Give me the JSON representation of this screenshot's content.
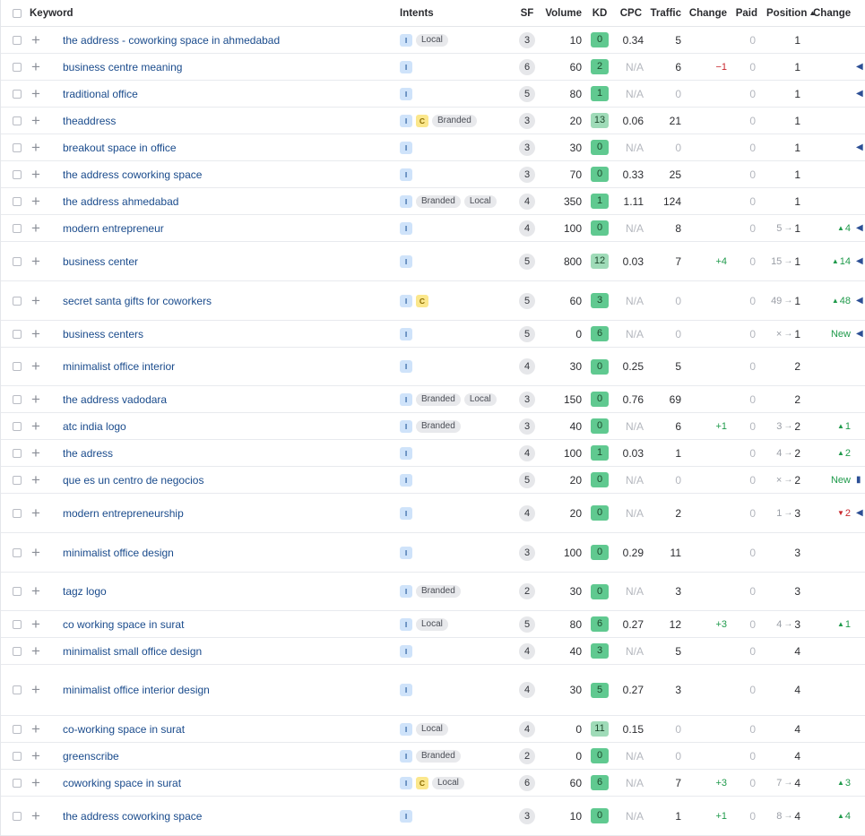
{
  "header": {
    "keyword": "Keyword",
    "intents": "Intents",
    "sf": "SF",
    "volume": "Volume",
    "kd": "KD",
    "cpc": "CPC",
    "traffic": "Traffic",
    "traffic_change": "Change",
    "paid": "Paid",
    "position": "Position",
    "position_sort_icon": "▲",
    "position_change": "Change"
  },
  "colors": {
    "link": "#1a4b8c",
    "kd_green": "#60c990",
    "kd_light_green": "#9fdbb8",
    "positive": "#1f9a4b",
    "negative": "#c8262c",
    "intent_i_bg": "#cfe3fa",
    "intent_c_bg": "#fbe78c"
  },
  "rows": [
    {
      "keyword": "the address - coworking space in ahmedabad",
      "intents": [
        "I"
      ],
      "tags": [
        "Local"
      ],
      "sf": "3",
      "volume": "10",
      "kd": "0",
      "cpc": "0.34",
      "traffic": "5",
      "tchg": "",
      "paid": "0",
      "prev": "",
      "pos": "1",
      "pchg": "",
      "pchg_dir": "",
      "feature": "",
      "h": 29
    },
    {
      "keyword": "business centre meaning",
      "intents": [
        "I"
      ],
      "tags": [],
      "sf": "6",
      "volume": "60",
      "kd": "2",
      "cpc": "N/A",
      "traffic": "6",
      "tchg": "−1",
      "tchg_dir": "down",
      "paid": "0",
      "prev": "",
      "pos": "1",
      "pchg": "",
      "pchg_dir": "",
      "feature": "◀",
      "h": 29
    },
    {
      "keyword": "traditional office",
      "intents": [
        "I"
      ],
      "tags": [],
      "sf": "5",
      "volume": "80",
      "kd": "1",
      "cpc": "N/A",
      "traffic": "0",
      "tchg": "",
      "paid": "0",
      "prev": "",
      "pos": "1",
      "pchg": "",
      "pchg_dir": "",
      "feature": "◀",
      "h": 29
    },
    {
      "keyword": "theaddress",
      "intents": [
        "I",
        "C"
      ],
      "tags": [
        "Branded"
      ],
      "sf": "3",
      "volume": "20",
      "kd": "13",
      "cpc": "0.06",
      "traffic": "21",
      "tchg": "",
      "paid": "0",
      "prev": "",
      "pos": "1",
      "pchg": "",
      "pchg_dir": "",
      "feature": "",
      "h": 29
    },
    {
      "keyword": "breakout space in office",
      "intents": [
        "I"
      ],
      "tags": [],
      "sf": "3",
      "volume": "30",
      "kd": "0",
      "cpc": "N/A",
      "traffic": "0",
      "tchg": "",
      "paid": "0",
      "prev": "",
      "pos": "1",
      "pchg": "",
      "pchg_dir": "",
      "feature": "◀",
      "h": 29
    },
    {
      "keyword": "the address coworking space",
      "intents": [
        "I"
      ],
      "tags": [],
      "sf": "3",
      "volume": "70",
      "kd": "0",
      "cpc": "0.33",
      "traffic": "25",
      "tchg": "",
      "paid": "0",
      "prev": "",
      "pos": "1",
      "pchg": "",
      "pchg_dir": "",
      "feature": "",
      "h": 29
    },
    {
      "keyword": "the address ahmedabad",
      "intents": [
        "I"
      ],
      "tags": [
        "Branded",
        "Local"
      ],
      "sf": "4",
      "volume": "350",
      "kd": "1",
      "cpc": "1.11",
      "traffic": "124",
      "tchg": "",
      "paid": "0",
      "prev": "",
      "pos": "1",
      "pchg": "",
      "pchg_dir": "",
      "feature": "",
      "h": 29
    },
    {
      "keyword": "modern entrepreneur",
      "intents": [
        "I"
      ],
      "tags": [],
      "sf": "4",
      "volume": "100",
      "kd": "0",
      "cpc": "N/A",
      "traffic": "8",
      "tchg": "",
      "paid": "0",
      "prev": "5",
      "pos": "1",
      "pchg": "4",
      "pchg_dir": "up",
      "feature": "◀",
      "h": 29
    },
    {
      "keyword": "business center",
      "intents": [
        "I"
      ],
      "tags": [],
      "sf": "5",
      "volume": "800",
      "kd": "12",
      "cpc": "0.03",
      "traffic": "7",
      "tchg": "+4",
      "tchg_dir": "up",
      "paid": "0",
      "prev": "15",
      "pos": "1",
      "pchg": "14",
      "pchg_dir": "up",
      "feature": "◀",
      "h": 43
    },
    {
      "keyword": "secret santa gifts for coworkers",
      "intents": [
        "I",
        "C"
      ],
      "tags": [],
      "sf": "5",
      "volume": "60",
      "kd": "3",
      "cpc": "N/A",
      "traffic": "0",
      "tchg": "",
      "paid": "0",
      "prev": "49",
      "pos": "1",
      "pchg": "48",
      "pchg_dir": "up",
      "feature": "◀",
      "h": 43
    },
    {
      "keyword": "business centers",
      "intents": [
        "I"
      ],
      "tags": [],
      "sf": "5",
      "volume": "0",
      "kd": "6",
      "cpc": "N/A",
      "traffic": "0",
      "tchg": "",
      "paid": "0",
      "prev": "×",
      "pos": "1",
      "pchg": "New",
      "pchg_dir": "new",
      "feature": "◀",
      "h": 29
    },
    {
      "keyword": "minimalist office interior",
      "intents": [
        "I"
      ],
      "tags": [],
      "sf": "4",
      "volume": "30",
      "kd": "0",
      "cpc": "0.25",
      "traffic": "5",
      "tchg": "",
      "paid": "0",
      "prev": "",
      "pos": "2",
      "pchg": "",
      "pchg_dir": "",
      "feature": "",
      "h": 42
    },
    {
      "keyword": "the address vadodara",
      "intents": [
        "I"
      ],
      "tags": [
        "Branded",
        "Local"
      ],
      "sf": "3",
      "volume": "150",
      "kd": "0",
      "cpc": "0.76",
      "traffic": "69",
      "tchg": "",
      "paid": "0",
      "prev": "",
      "pos": "2",
      "pchg": "",
      "pchg_dir": "",
      "feature": "",
      "h": 29
    },
    {
      "keyword": "atc india logo",
      "intents": [
        "I"
      ],
      "tags": [
        "Branded"
      ],
      "sf": "3",
      "volume": "40",
      "kd": "0",
      "cpc": "N/A",
      "traffic": "6",
      "tchg": "+1",
      "tchg_dir": "up",
      "paid": "0",
      "prev": "3",
      "pos": "2",
      "pchg": "1",
      "pchg_dir": "up",
      "feature": "",
      "h": 29
    },
    {
      "keyword": "the adress",
      "intents": [
        "I"
      ],
      "tags": [],
      "sf": "4",
      "volume": "100",
      "kd": "1",
      "cpc": "0.03",
      "traffic": "1",
      "tchg": "",
      "paid": "0",
      "prev": "4",
      "pos": "2",
      "pchg": "2",
      "pchg_dir": "up",
      "feature": "",
      "h": 29
    },
    {
      "keyword": "que es un centro de negocios",
      "intents": [
        "I"
      ],
      "tags": [],
      "sf": "5",
      "volume": "20",
      "kd": "0",
      "cpc": "N/A",
      "traffic": "0",
      "tchg": "",
      "paid": "0",
      "prev": "×",
      "pos": "2",
      "pchg": "New",
      "pchg_dir": "new",
      "feature": "▮",
      "h": 29
    },
    {
      "keyword": "modern entrepreneurship",
      "intents": [
        "I"
      ],
      "tags": [],
      "sf": "4",
      "volume": "20",
      "kd": "0",
      "cpc": "N/A",
      "traffic": "2",
      "tchg": "",
      "paid": "0",
      "prev": "1",
      "pos": "3",
      "pchg": "2",
      "pchg_dir": "down",
      "feature": "◀",
      "h": 43
    },
    {
      "keyword": "minimalist office design",
      "intents": [
        "I"
      ],
      "tags": [],
      "sf": "3",
      "volume": "100",
      "kd": "0",
      "cpc": "0.29",
      "traffic": "11",
      "tchg": "",
      "paid": "0",
      "prev": "",
      "pos": "3",
      "pchg": "",
      "pchg_dir": "",
      "feature": "",
      "h": 43
    },
    {
      "keyword": "tagz logo",
      "intents": [
        "I"
      ],
      "tags": [
        "Branded"
      ],
      "sf": "2",
      "volume": "30",
      "kd": "0",
      "cpc": "N/A",
      "traffic": "3",
      "tchg": "",
      "paid": "0",
      "prev": "",
      "pos": "3",
      "pchg": "",
      "pchg_dir": "",
      "feature": "",
      "h": 42
    },
    {
      "keyword": "co working space in surat",
      "intents": [
        "I"
      ],
      "tags": [
        "Local"
      ],
      "sf": "5",
      "volume": "80",
      "kd": "6",
      "cpc": "0.27",
      "traffic": "12",
      "tchg": "+3",
      "tchg_dir": "up",
      "paid": "0",
      "prev": "4",
      "pos": "3",
      "pchg": "1",
      "pchg_dir": "up",
      "feature": "",
      "h": 29
    },
    {
      "keyword": "minimalist small office design",
      "intents": [
        "I"
      ],
      "tags": [],
      "sf": "4",
      "volume": "40",
      "kd": "3",
      "cpc": "N/A",
      "traffic": "5",
      "tchg": "",
      "paid": "0",
      "prev": "",
      "pos": "4",
      "pchg": "",
      "pchg_dir": "",
      "feature": "",
      "h": 29
    },
    {
      "keyword": "minimalist office interior design",
      "intents": [
        "I"
      ],
      "tags": [],
      "sf": "4",
      "volume": "30",
      "kd": "5",
      "cpc": "0.27",
      "traffic": "3",
      "tchg": "",
      "paid": "0",
      "prev": "",
      "pos": "4",
      "pchg": "",
      "pchg_dir": "",
      "feature": "",
      "h": 56
    },
    {
      "keyword": "co-working space in surat",
      "intents": [
        "I"
      ],
      "tags": [
        "Local"
      ],
      "sf": "4",
      "volume": "0",
      "kd": "11",
      "cpc": "0.15",
      "traffic": "0",
      "tchg": "",
      "paid": "0",
      "prev": "",
      "pos": "4",
      "pchg": "",
      "pchg_dir": "",
      "feature": "",
      "h": 29
    },
    {
      "keyword": "greenscribe",
      "intents": [
        "I"
      ],
      "tags": [
        "Branded"
      ],
      "sf": "2",
      "volume": "0",
      "kd": "0",
      "cpc": "N/A",
      "traffic": "0",
      "tchg": "",
      "paid": "0",
      "prev": "",
      "pos": "4",
      "pchg": "",
      "pchg_dir": "",
      "feature": "",
      "h": 29
    },
    {
      "keyword": "coworking space in surat",
      "intents": [
        "I",
        "C"
      ],
      "tags": [
        "Local"
      ],
      "sf": "6",
      "volume": "60",
      "kd": "6",
      "cpc": "N/A",
      "traffic": "7",
      "tchg": "+3",
      "tchg_dir": "up",
      "paid": "0",
      "prev": "7",
      "pos": "4",
      "pchg": "3",
      "pchg_dir": "up",
      "feature": "",
      "h": 29
    },
    {
      "keyword": "the address coworking space",
      "intents": [
        "I"
      ],
      "tags": [],
      "sf": "3",
      "volume": "10",
      "kd": "0",
      "cpc": "N/A",
      "traffic": "1",
      "tchg": "+1",
      "tchg_dir": "up",
      "paid": "0",
      "prev": "8",
      "pos": "4",
      "pchg": "4",
      "pchg_dir": "up",
      "feature": "",
      "h": 43
    }
  ]
}
